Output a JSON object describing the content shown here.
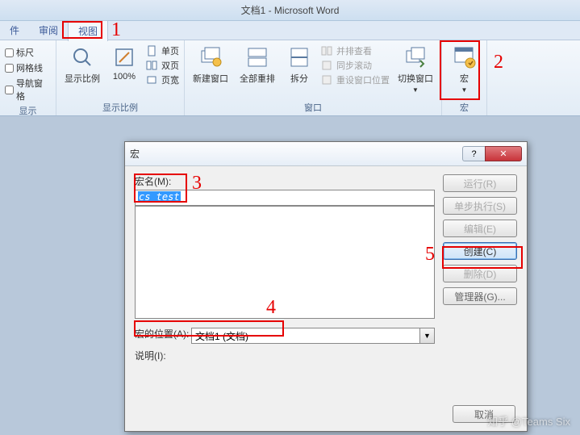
{
  "app": {
    "title": "文档1 - Microsoft Word"
  },
  "tabs": {
    "file": "件",
    "review": "审阅",
    "view": "视图"
  },
  "ribbon": {
    "show_group": {
      "ruler": "标尺",
      "gridlines": "网格线",
      "nav_pane": "导航窗格",
      "label": "显示"
    },
    "zoom_group": {
      "zoom": "显示比例",
      "hundred": "100%",
      "one_page": "单页",
      "two_pages": "双页",
      "page_width": "页宽",
      "label": "显示比例"
    },
    "window_group": {
      "new_window": "新建窗口",
      "arrange_all": "全部重排",
      "split": "拆分",
      "side_by_side": "并排查看",
      "sync_scroll": "同步滚动",
      "reset_pos": "重设窗口位置",
      "switch": "切换窗口",
      "label": "窗口"
    },
    "macros_group": {
      "macros": "宏",
      "label": "宏"
    }
  },
  "dialog": {
    "title": "宏",
    "macro_name_label": "宏名(M):",
    "macro_name_value": "cs_test",
    "macros_in_label": "宏的位置(A):",
    "macros_in_value": "文档1 (文档)",
    "description_label": "说明(I):",
    "buttons": {
      "run": "运行(R)",
      "step": "单步执行(S)",
      "edit": "编辑(E)",
      "create": "创建(C)",
      "delete": "删除(D)",
      "organizer": "管理器(G)...",
      "cancel": "取消"
    },
    "help": "?",
    "close": "✕"
  },
  "annotations": {
    "n1": "1",
    "n2": "2",
    "n3": "3",
    "n4": "4",
    "n5": "5"
  },
  "watermark": "知乎 @Teams Six"
}
